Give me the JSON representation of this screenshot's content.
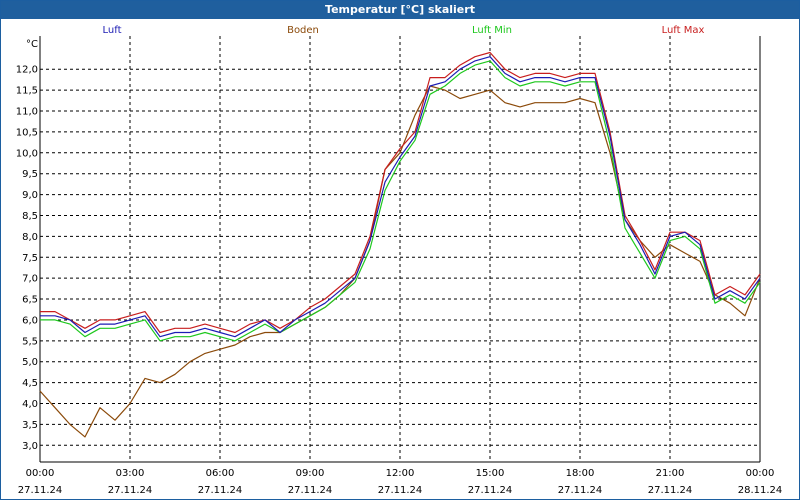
{
  "title": "Temperatur [°C] skaliert",
  "chart_data": {
    "type": "line",
    "ylabel": "°C",
    "ylim": [
      2.6,
      12.7
    ],
    "y_ticks": [
      "3,0",
      "3,5",
      "4,0",
      "4,5",
      "5,0",
      "5,5",
      "6,0",
      "6,5",
      "7,0",
      "7,5",
      "8,0",
      "8,5",
      "9,0",
      "9,5",
      "10,0",
      "10,5",
      "11,0",
      "11,5",
      "12,0"
    ],
    "xlim": [
      0,
      24
    ],
    "x_ticks": [
      {
        "h": 0,
        "time": "00:00",
        "date": "27.11.24"
      },
      {
        "h": 3,
        "time": "03:00",
        "date": "27.11.24"
      },
      {
        "h": 6,
        "time": "06:00",
        "date": "27.11.24"
      },
      {
        "h": 9,
        "time": "09:00",
        "date": "27.11.24"
      },
      {
        "h": 12,
        "time": "12:00",
        "date": "27.11.24"
      },
      {
        "h": 15,
        "time": "15:00",
        "date": "27.11.24"
      },
      {
        "h": 18,
        "time": "18:00",
        "date": "27.11.24"
      },
      {
        "h": 21,
        "time": "21:00",
        "date": "27.11.24"
      },
      {
        "h": 24,
        "time": "00:00",
        "date": "28.11.24"
      }
    ],
    "grid": true,
    "x": [
      0,
      0.5,
      1,
      1.5,
      2,
      2.5,
      3,
      3.5,
      4,
      4.5,
      5,
      5.5,
      6,
      6.5,
      7,
      7.5,
      8,
      8.5,
      9,
      9.5,
      10,
      10.5,
      11,
      11.5,
      12,
      12.5,
      13,
      13.5,
      14,
      14.5,
      15,
      15.5,
      16,
      16.5,
      17,
      17.5,
      18,
      18.5,
      19,
      19.5,
      20,
      20.5,
      21,
      21.5,
      22,
      22.5,
      23,
      23.5,
      24
    ],
    "series": [
      {
        "name": "Luft",
        "color": "#1c1cb4",
        "values": [
          6.1,
          6.1,
          6.0,
          5.7,
          5.9,
          5.9,
          6.0,
          6.1,
          5.6,
          5.7,
          5.7,
          5.8,
          5.7,
          5.6,
          5.8,
          6.0,
          5.7,
          6.0,
          6.2,
          6.4,
          6.7,
          7.0,
          7.9,
          9.3,
          9.9,
          10.4,
          11.6,
          11.7,
          12.0,
          12.2,
          12.3,
          11.9,
          11.7,
          11.8,
          11.8,
          11.7,
          11.8,
          11.8,
          10.4,
          8.4,
          7.8,
          7.1,
          8.0,
          8.1,
          7.8,
          6.5,
          6.7,
          6.5,
          7.0
        ]
      },
      {
        "name": "Boden",
        "color": "#8b4a0a",
        "values": [
          4.3,
          3.9,
          3.5,
          3.2,
          3.9,
          3.6,
          4.0,
          4.6,
          4.5,
          4.7,
          5.0,
          5.2,
          5.3,
          5.4,
          5.6,
          5.7,
          5.7,
          5.9,
          6.1,
          6.3,
          6.6,
          7.0,
          7.9,
          9.6,
          10.0,
          10.9,
          11.6,
          11.5,
          11.3,
          11.4,
          11.5,
          11.2,
          11.1,
          11.2,
          11.2,
          11.2,
          11.3,
          11.2,
          10.0,
          8.4,
          7.9,
          7.5,
          7.8,
          7.6,
          7.4,
          6.6,
          6.4,
          6.1,
          7.0
        ]
      },
      {
        "name": "Luft Min",
        "color": "#1ec81e",
        "values": [
          6.0,
          6.0,
          5.9,
          5.6,
          5.8,
          5.8,
          5.9,
          6.0,
          5.5,
          5.6,
          5.6,
          5.7,
          5.6,
          5.5,
          5.7,
          5.9,
          5.7,
          5.9,
          6.1,
          6.3,
          6.6,
          6.9,
          7.7,
          9.1,
          9.8,
          10.3,
          11.4,
          11.6,
          11.9,
          12.1,
          12.2,
          11.8,
          11.6,
          11.7,
          11.7,
          11.6,
          11.7,
          11.7,
          10.2,
          8.2,
          7.6,
          7.0,
          7.9,
          8.0,
          7.7,
          6.4,
          6.6,
          6.4,
          6.9
        ]
      },
      {
        "name": "Luft Max",
        "color": "#c81e1e",
        "values": [
          6.2,
          6.2,
          6.0,
          5.8,
          6.0,
          6.0,
          6.1,
          6.2,
          5.7,
          5.8,
          5.8,
          5.9,
          5.8,
          5.7,
          5.9,
          6.0,
          5.8,
          6.0,
          6.3,
          6.5,
          6.8,
          7.1,
          8.0,
          9.6,
          10.1,
          10.5,
          11.8,
          11.8,
          12.1,
          12.3,
          12.4,
          12.0,
          11.8,
          11.9,
          11.9,
          11.8,
          11.9,
          11.9,
          10.5,
          8.5,
          7.9,
          7.2,
          8.1,
          8.1,
          7.9,
          6.6,
          6.8,
          6.6,
          7.1
        ]
      }
    ]
  }
}
